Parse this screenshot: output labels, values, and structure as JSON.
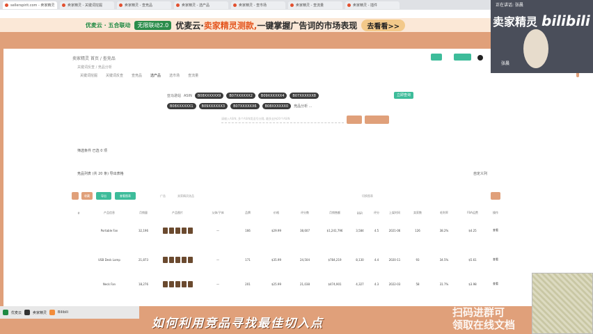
{
  "browser": {
    "tabs": [
      "sellerspirit.com - 卖家精灵",
      "卖家精灵 - 关键词挖掘",
      "卖家精灵 - 查竞品",
      "卖家精灵 - 选产品",
      "卖家精灵 - 查市场",
      "卖家精灵 - 查流量",
      "卖家精灵 - 插件"
    ]
  },
  "banner": {
    "brand": "优麦云 · 五合联动",
    "pill": "无限联动2.0",
    "headline_prefix": "优麦云·",
    "headline_highlight": "卖家精灵测款,",
    "headline_suffix": "一键掌握广告词的市场表现",
    "cta": "去看看>>"
  },
  "site": {
    "logo": "卖家精灵",
    "subtitle": "首页 / 查竞品",
    "breadcrumb": "关键词反查 / 竞品分析",
    "nav": [
      "关键词挖掘",
      "关键词反查",
      "查竞品",
      "选产品",
      "选市场",
      "查流量"
    ]
  },
  "search": {
    "label": "亚马逊站",
    "field_label": "ASIN",
    "chips_row1": [
      "B08XXXXXX9",
      "B07XXXXXX2",
      "B09XXXXXX4",
      "B07XXXXXX8"
    ],
    "chips_row2": [
      "B08XXXXXX1",
      "B09XXXXXX3",
      "B07XXXXXX6",
      "B08XXXXXX0"
    ],
    "hint": "竞品分析 ...",
    "button": "立即查询",
    "input_placeholder": "请输入ASIN, 多个ASIN用逗号分隔, 最多支持20个ASIN"
  },
  "sections": {
    "filter": "筛选条件",
    "filter_value": "已选 0 项",
    "results": "竞品列表 (共 20 条)",
    "results_sub": "导出表格",
    "right_action": "自定义列"
  },
  "toolbar": {
    "b1": "收藏",
    "b2": "导出",
    "b3": "查看图表",
    "t1": "广告",
    "t2": "卖家精灵选品",
    "t3": "切换图表"
  },
  "table": {
    "headers": [
      "#",
      "产品信息",
      "月销量",
      "产品图片",
      "父体/子体",
      "品牌",
      "价格",
      "评分数",
      "月销售额",
      "BSR",
      "评分",
      "上架时间",
      "卖家数",
      "毛利率",
      "FBA运费",
      "操作"
    ],
    "rows": [
      [
        "1",
        "Portable Fan",
        "32,196",
        "",
        "—",
        "166",
        "$29.99",
        "38,607",
        "$1,241,796",
        "3,584",
        "4.5",
        "2021-06",
        "126",
        "38.2%",
        "$4.25",
        "查看"
      ],
      [
        "2",
        "USB Desk Lamp",
        "21,873",
        "",
        "—",
        "171",
        "$35.99",
        "24,504",
        "$784,219",
        "8,130",
        "4.4",
        "2020-11",
        "93",
        "34.5%",
        "$5.61",
        "查看"
      ],
      [
        "3",
        "Neck Fan",
        "18,276",
        "",
        "—",
        "201",
        "$25.99",
        "21,038",
        "$474,901",
        "4,327",
        "4.3",
        "2022-03",
        "58",
        "31.7%",
        "$3.98",
        "查看"
      ]
    ]
  },
  "side": {
    "status": "正在讲话: 张晨",
    "title": "卖家精灵",
    "brand": "bilibili",
    "speaker": "张晨"
  },
  "taskbar": {
    "items": [
      "优麦云",
      "卖家精灵",
      "Bilibili"
    ]
  },
  "subtitle": "如何利用竞品寻找最佳切入点",
  "watermark": [
    "扫码进群可",
    "领取在线文档"
  ],
  "colors": {
    "accent": "#3dbc9a",
    "frame": "#e0a07a",
    "banner_bg": "#fbe8d7"
  }
}
